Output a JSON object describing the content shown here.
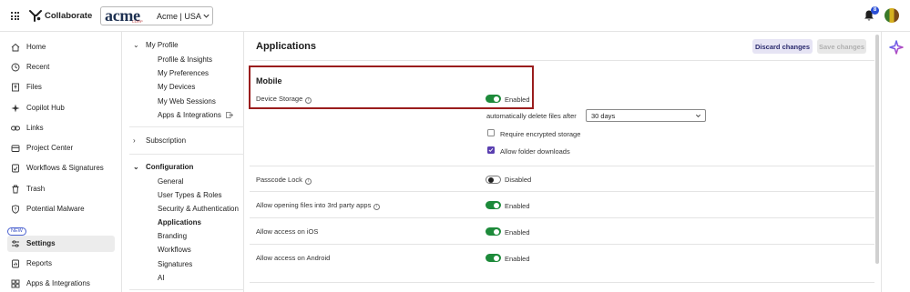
{
  "topbar": {
    "app_name": "Collaborate",
    "logo_text": "acme",
    "logo_subtext": "CORP",
    "tenant": "Acme | USA",
    "notification_count": "8"
  },
  "sidebar": {
    "new_badge": "NEW",
    "items": [
      {
        "label": "Home",
        "icon": "home-icon"
      },
      {
        "label": "Recent",
        "icon": "clock-icon"
      },
      {
        "label": "Files",
        "icon": "file-icon"
      },
      {
        "label": "Copilot Hub",
        "icon": "copilot-icon"
      },
      {
        "label": "Links",
        "icon": "link-icon"
      },
      {
        "label": "Project Center",
        "icon": "project-icon"
      },
      {
        "label": "Workflows & Signatures",
        "icon": "workflow-icon"
      },
      {
        "label": "Trash",
        "icon": "trash-icon"
      },
      {
        "label": "Potential Malware",
        "icon": "shield-icon"
      },
      {
        "label": "Settings",
        "icon": "settings-icon"
      },
      {
        "label": "Reports",
        "icon": "reports-icon"
      },
      {
        "label": "Apps & Integrations",
        "icon": "apps-icon"
      }
    ]
  },
  "subnav": {
    "my_profile": {
      "title": "My Profile",
      "items": [
        "Profile & Insights",
        "My Preferences",
        "My Devices",
        "My Web Sessions",
        "Apps & Integrations"
      ]
    },
    "subscription": {
      "title": "Subscription"
    },
    "configuration": {
      "title": "Configuration",
      "items": [
        "General",
        "User Types & Roles",
        "Security & Authentication",
        "Applications",
        "Branding",
        "Workflows",
        "Signatures",
        "AI"
      ]
    }
  },
  "main": {
    "title": "Applications",
    "discard_label": "Discard changes",
    "save_label": "Save changes",
    "mobile_section": "Mobile",
    "device_storage": {
      "label": "Device Storage",
      "status": "Enabled"
    },
    "auto_delete": {
      "label": "automatically delete files after",
      "value": "30 days"
    },
    "require_encrypted": {
      "label": "Require encrypted storage",
      "checked": false
    },
    "allow_folder_downloads": {
      "label": "Allow folder downloads",
      "checked": true
    },
    "passcode_lock": {
      "label": "Passcode Lock",
      "status": "Disabled"
    },
    "third_party": {
      "label": "Allow opening files into 3rd party apps",
      "status": "Enabled"
    },
    "ios": {
      "label": "Allow access on iOS",
      "status": "Enabled"
    },
    "android": {
      "label": "Allow access on Android",
      "status": "Enabled"
    }
  },
  "colors": {
    "toggle_on": "#1d8a3a",
    "highlight_border": "#9a1d1d",
    "checkbox_checked": "#5a3fb0",
    "badge": "#2a4fd6"
  }
}
